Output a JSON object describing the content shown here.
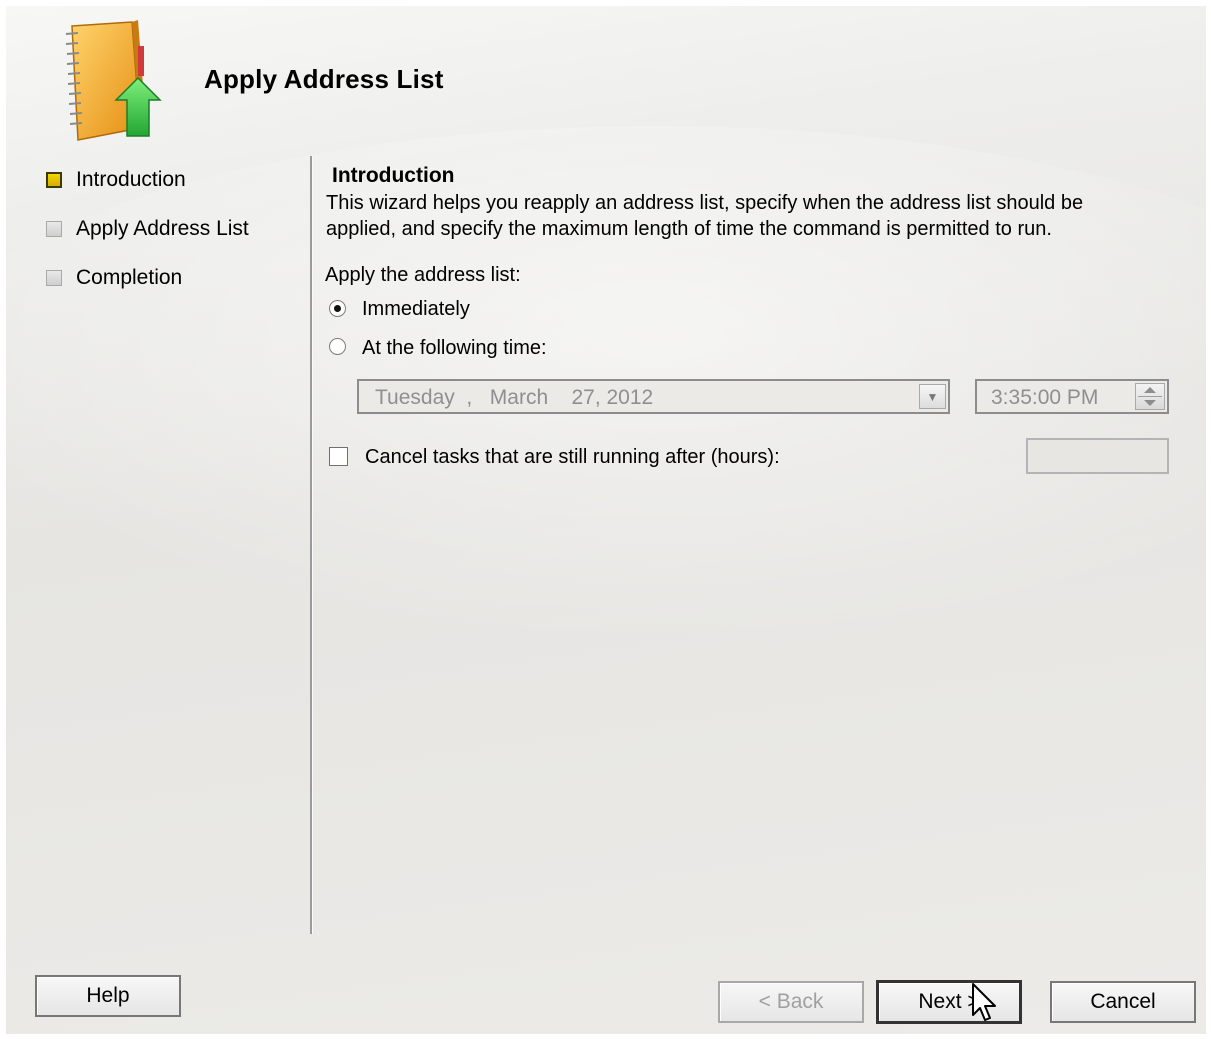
{
  "wizard": {
    "title": "Apply Address List",
    "steps": [
      {
        "label": "Introduction",
        "active": true
      },
      {
        "label": "Apply Address List",
        "active": false
      },
      {
        "label": "Completion",
        "active": false
      }
    ],
    "section_title": "Introduction",
    "description": "This wizard helps you reapply an address list, specify when the address list should be applied, and specify the maximum length of time the command is permitted to run.",
    "apply_label": "Apply the address list:",
    "options": {
      "immediately": "Immediately",
      "at_time": "At the following time:"
    },
    "selected_option": "immediately",
    "date_value": "Tuesday  ,   March    27, 2012",
    "time_value": "3:35:00 PM",
    "cancel_tasks_label": "Cancel tasks that are still running after (hours):",
    "cancel_tasks_checked": false,
    "hours_value": ""
  },
  "buttons": {
    "help": "Help",
    "back": "< Back",
    "next": "Next >",
    "cancel": "Cancel"
  },
  "icons": {
    "header": "address-book-apply-icon",
    "cursor": "mouse-pointer-icon"
  },
  "colors": {
    "active_step": "#e8c200",
    "disabled_text": "#8f8f8f"
  }
}
